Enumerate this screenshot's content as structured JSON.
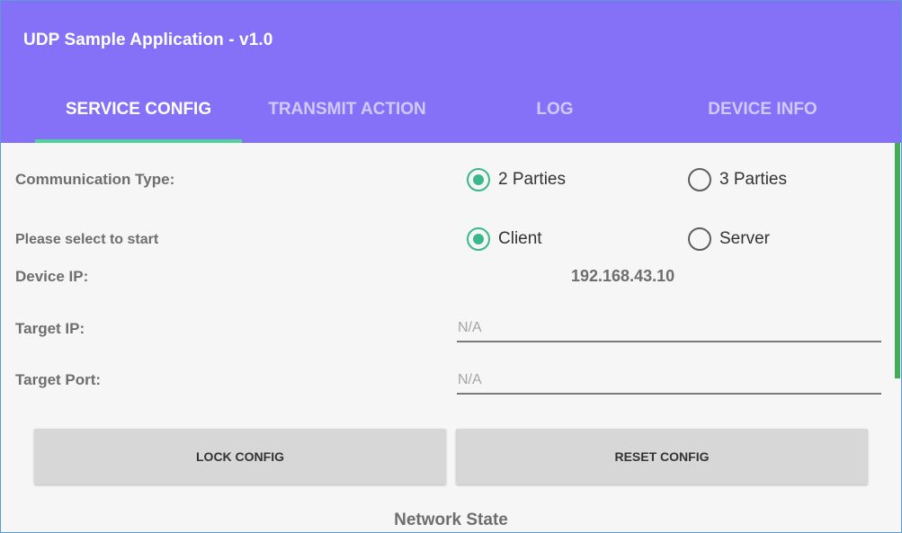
{
  "app": {
    "title": "UDP Sample Application - v1.0",
    "accent": "#8571f8",
    "indicator_color": "#4fd39a"
  },
  "tabs": [
    {
      "label": "SERVICE CONFIG",
      "active": true
    },
    {
      "label": "TRANSMIT ACTION",
      "active": false
    },
    {
      "label": "LOG",
      "active": false
    },
    {
      "label": "DEVICE INFO",
      "active": false
    }
  ],
  "config": {
    "communication_type_label": "Communication Type:",
    "communication_options": [
      {
        "label": "2 Parties",
        "checked": true
      },
      {
        "label": "3 Parties",
        "checked": false
      }
    ],
    "role_label": "Please select to start",
    "role_options": [
      {
        "label": "Client",
        "checked": true
      },
      {
        "label": "Server",
        "checked": false
      }
    ],
    "device_ip_label": "Device IP:",
    "device_ip_value": "192.168.43.10",
    "target_ip_label": "Target IP:",
    "target_ip_placeholder": "N/A",
    "target_ip_value": "",
    "target_port_label": "Target Port:",
    "target_port_placeholder": "N/A",
    "target_port_value": ""
  },
  "buttons": {
    "lock_label": "LOCK CONFIG",
    "reset_label": "RESET CONFIG"
  },
  "network_state": {
    "title": "Network State"
  },
  "radio_checked_color": "#3cb88a"
}
